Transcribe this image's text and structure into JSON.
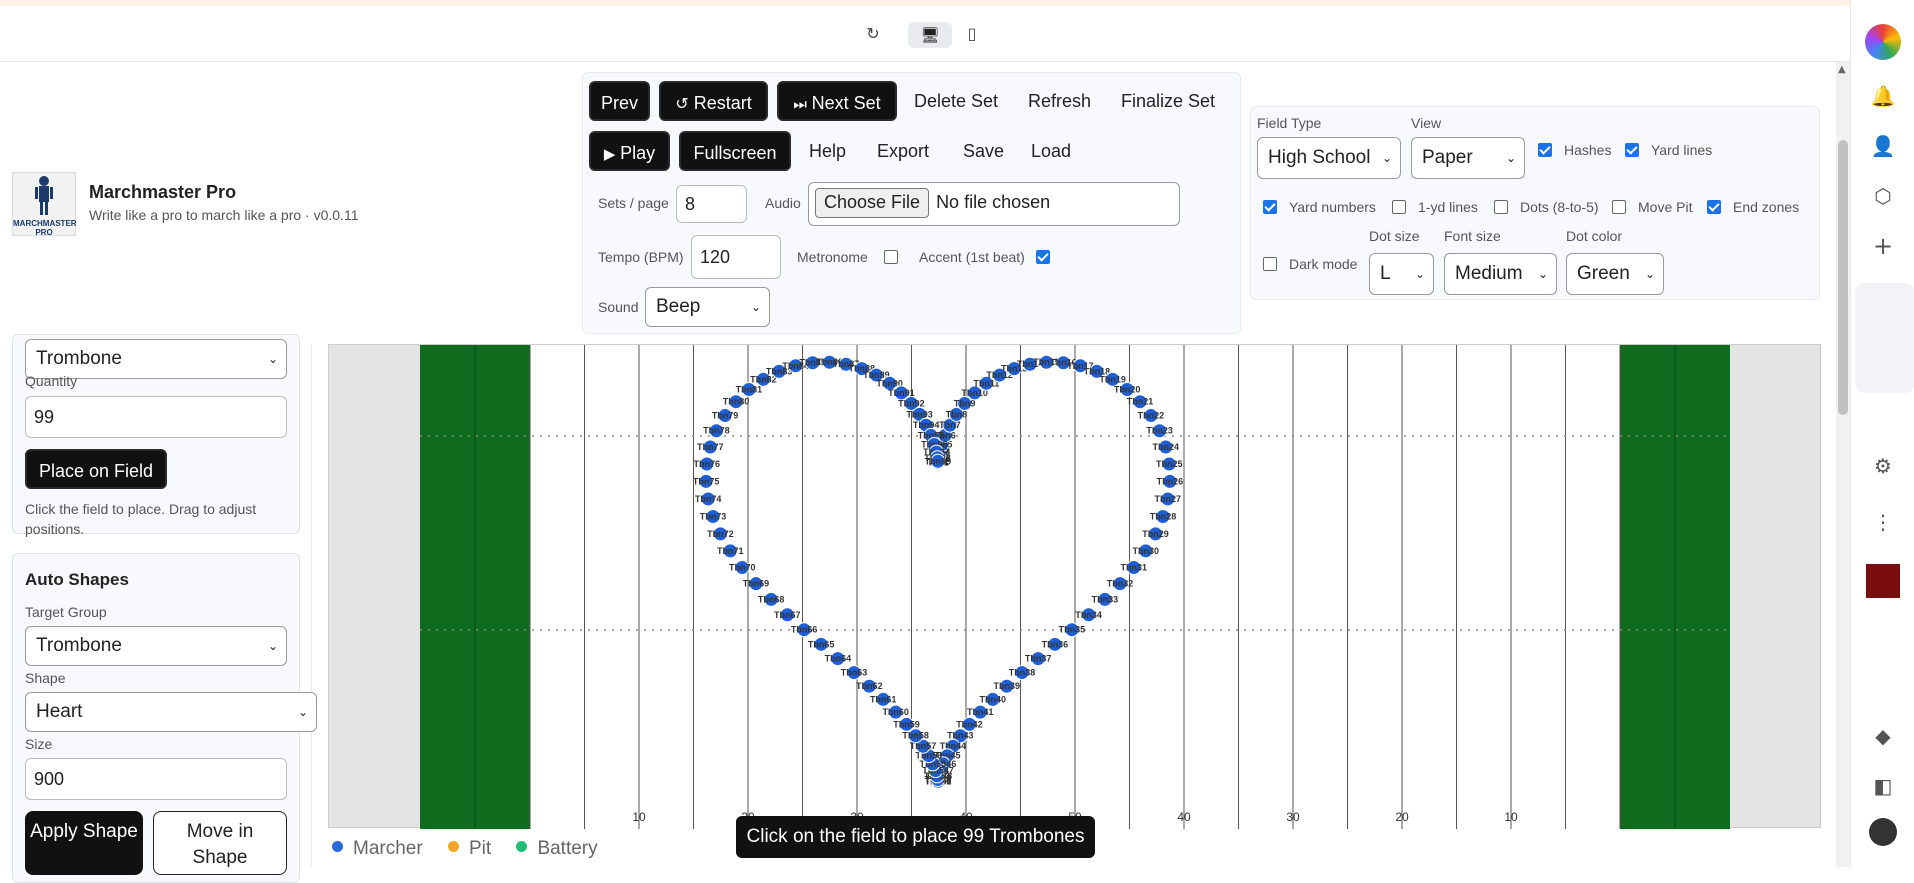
{
  "app": {
    "title": "Marchmaster Pro",
    "subtitle": "Write like a pro to march like a pro · v0.0.11",
    "logo_text": "MARCHMASTER PRO"
  },
  "toolbar": {
    "prev": "Prev",
    "restart": "Restart",
    "next_set": "Next Set",
    "delete_set": "Delete Set",
    "refresh": "Refresh",
    "finalize_set": "Finalize Set",
    "play": "Play",
    "fullscreen": "Fullscreen",
    "help": "Help",
    "export": "Export",
    "save": "Save",
    "load": "Load",
    "sets_per_page_label": "Sets / page",
    "sets_per_page_value": "8",
    "audio_label": "Audio",
    "choose_file": "Choose File",
    "no_file": "No file chosen",
    "tempo_label": "Tempo (BPM)",
    "tempo_value": "120",
    "metronome_label": "Metronome",
    "metronome_checked": false,
    "accent_label": "Accent (1st beat)",
    "accent_checked": true,
    "sound_label": "Sound",
    "sound_value": "Beep"
  },
  "field_settings": {
    "field_type_label": "Field Type",
    "field_type_value": "High School",
    "view_label": "View",
    "view_value": "Paper",
    "hashes_label": "Hashes",
    "hashes_checked": true,
    "yard_lines_label": "Yard lines",
    "yard_lines_checked": true,
    "yard_numbers_label": "Yard numbers",
    "yard_numbers_checked": true,
    "one_yd_label": "1-yd lines",
    "one_yd_checked": false,
    "dots_label": "Dots (8-to-5)",
    "dots_checked": false,
    "move_pit_label": "Move Pit",
    "move_pit_checked": false,
    "end_zones_label": "End zones",
    "end_zones_checked": true,
    "dark_mode_label": "Dark mode",
    "dark_mode_checked": false,
    "dot_size_label": "Dot size",
    "dot_size_value": "L",
    "font_size_label": "Font size",
    "font_size_value": "Medium",
    "dot_color_label": "Dot color",
    "dot_color_value": "Green"
  },
  "left_panel": {
    "group_select_value": "Trombone",
    "quantity_label": "Quantity",
    "quantity_value": "99",
    "place_button": "Place on Field",
    "place_hint": "Click the field to place. Drag to adjust positions.",
    "auto_shapes_title": "Auto Shapes",
    "target_group_label": "Target Group",
    "target_group_value": "Trombone",
    "shape_label": "Shape",
    "shape_value": "Heart",
    "size_label": "Size",
    "size_value": "900",
    "apply_shape": "Apply Shape",
    "move_in_shape": "Move in Shape"
  },
  "field": {
    "yard_numbers": [
      "10",
      "20",
      "30",
      "40",
      "50",
      "40",
      "30",
      "20",
      "10"
    ],
    "marker_prefix": "Tbn",
    "marker_color": "#1f5fd6",
    "end_zone_color": "#0f6b1e"
  },
  "legend": {
    "items": [
      {
        "label": "Marcher",
        "color": "#2a6ae0"
      },
      {
        "label": "Pit",
        "color": "#f5a623"
      },
      {
        "label": "Battery",
        "color": "#1fbf7a"
      }
    ]
  },
  "toast": "Click on the field to place 99 Trombones"
}
